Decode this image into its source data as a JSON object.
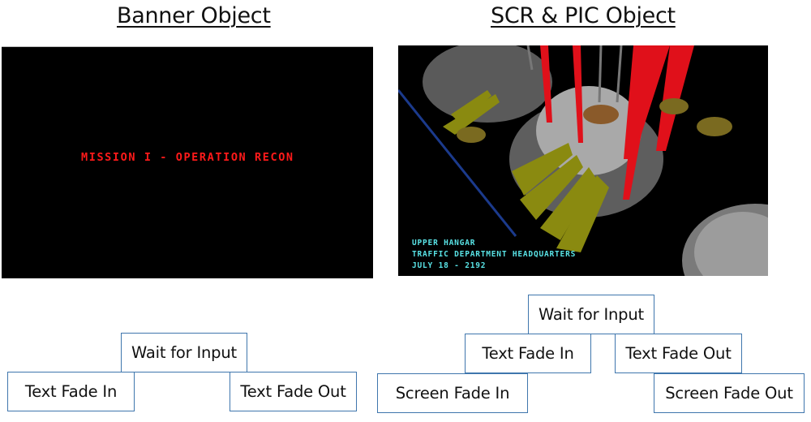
{
  "headings": {
    "banner": "Banner Object",
    "scr_pic": "SCR & PIC Object"
  },
  "banner_screen": {
    "text": "MISSION I - OPERATION RECON",
    "text_color": "#ff1a1a",
    "background": "#000000"
  },
  "scr_screen": {
    "caption": [
      "UPPER HANGAR",
      "TRAFFIC DEPARTMENT HEADQUARTERS",
      "JULY 18 - 2192"
    ],
    "caption_color": "#59e3e6",
    "background": "#000000"
  },
  "banner_flow": {
    "wait": "Wait for Input",
    "fade_in": "Text Fade In",
    "fade_out": "Text Fade Out"
  },
  "scr_flow": {
    "wait": "Wait for Input",
    "text_fade_in": "Text Fade In",
    "text_fade_out": "Text Fade Out",
    "screen_fade_in": "Screen Fade In",
    "screen_fade_out": "Screen Fade Out"
  },
  "colors": {
    "box_border": "#3f76ad"
  }
}
